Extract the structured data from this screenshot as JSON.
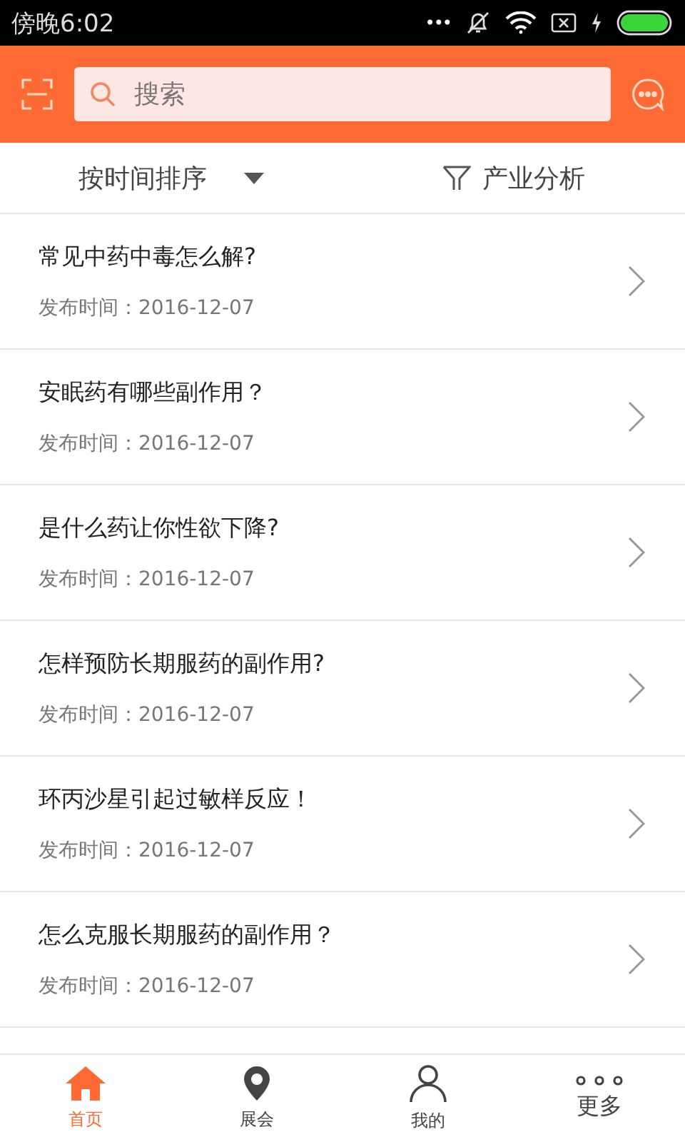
{
  "status_bar": {
    "time": "傍晚6:02",
    "dots": "•••"
  },
  "search": {
    "placeholder": "搜索"
  },
  "filter_bar": {
    "sort": "按时间排序",
    "analysis": "产业分析"
  },
  "articles": [
    {
      "title": "常见中药中毒怎么解?",
      "date": "发布时间：2016-12-07"
    },
    {
      "title": "安眠药有哪些副作用？",
      "date": "发布时间：2016-12-07"
    },
    {
      "title": "是什么药让你性欲下降?",
      "date": "发布时间：2016-12-07"
    },
    {
      "title": "怎样预防长期服药的副作用?",
      "date": "发布时间：2016-12-07"
    },
    {
      "title": "环丙沙星引起过敏样反应！",
      "date": "发布时间：2016-12-07"
    },
    {
      "title": "怎么克服长期服药的副作用？",
      "date": "发布时间：2016-12-07"
    }
  ],
  "tab_bar": [
    {
      "kind": "home",
      "label": "首页",
      "selected": true
    },
    {
      "kind": "pin",
      "label": "展会",
      "selected": false
    },
    {
      "kind": "person",
      "label": "我的",
      "selected": false
    },
    {
      "kind": "more",
      "label": "更多",
      "selected": false
    }
  ]
}
